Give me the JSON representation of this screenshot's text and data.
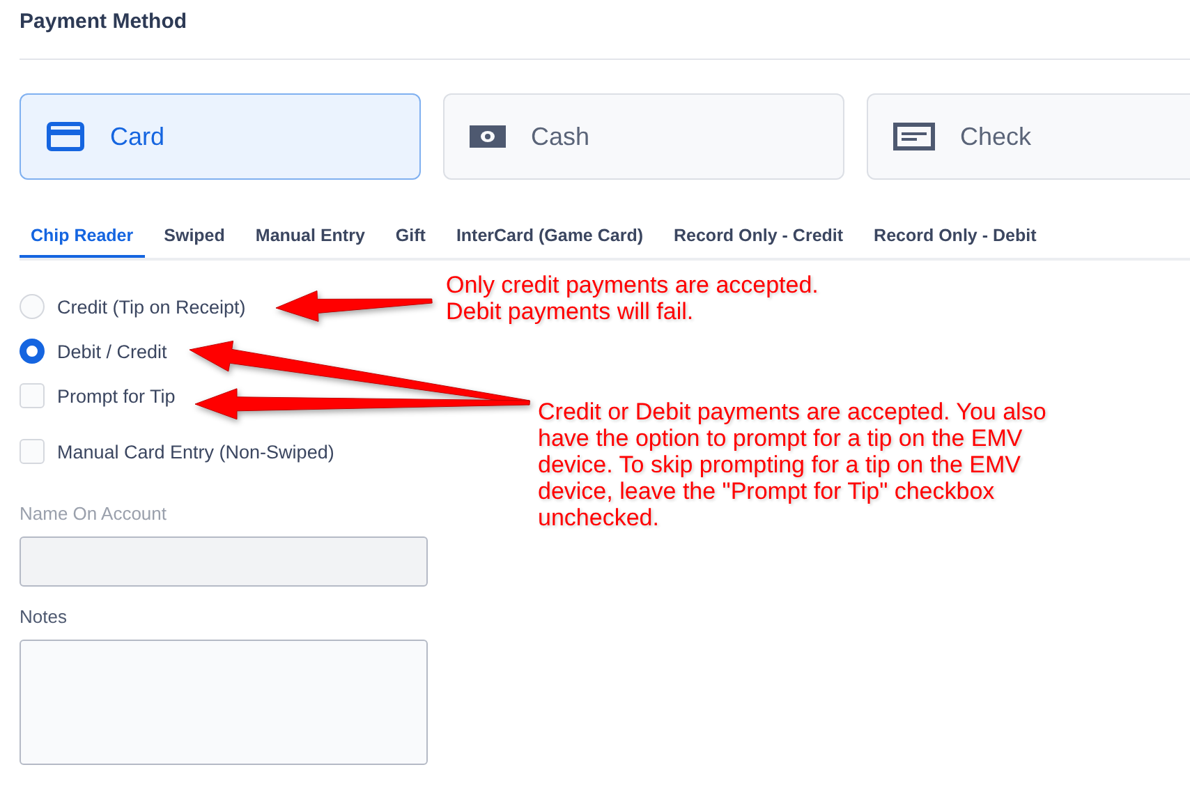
{
  "section_title": "Payment Method",
  "methods": [
    {
      "label": "Card",
      "kind": "card",
      "selected": true
    },
    {
      "label": "Cash",
      "kind": "cash",
      "selected": false
    },
    {
      "label": "Check",
      "kind": "check",
      "selected": false
    }
  ],
  "tabs": [
    {
      "label": "Chip Reader",
      "selected": true
    },
    {
      "label": "Swiped",
      "selected": false
    },
    {
      "label": "Manual Entry",
      "selected": false
    },
    {
      "label": "Gift",
      "selected": false
    },
    {
      "label": "InterCard (Game Card)",
      "selected": false
    },
    {
      "label": "Record Only - Credit",
      "selected": false
    },
    {
      "label": "Record Only - Debit",
      "selected": false
    }
  ],
  "options": [
    {
      "kind": "radio",
      "label": "Credit (Tip on Receipt)",
      "selected": false
    },
    {
      "kind": "radio",
      "label": "Debit / Credit",
      "selected": true
    },
    {
      "kind": "checkbox",
      "label": "Prompt for Tip",
      "checked": false
    },
    {
      "kind": "checkbox",
      "label": "Manual Card Entry (Non-Swiped)",
      "checked": false
    }
  ],
  "name_on_account": {
    "label": "Name On Account",
    "disabled": true
  },
  "notes": {
    "label": "Notes"
  },
  "annotations": [
    {
      "lines": [
        "Only credit payments are accepted.",
        "Debit payments will fail."
      ]
    },
    {
      "lines": [
        "Credit or Debit payments are accepted. You also",
        "have the option to prompt for a tip on the EMV",
        "device. To skip prompting for a tip on the EMV",
        "device, leave the \"Prompt for Tip\" checkbox",
        "unchecked."
      ]
    }
  ]
}
